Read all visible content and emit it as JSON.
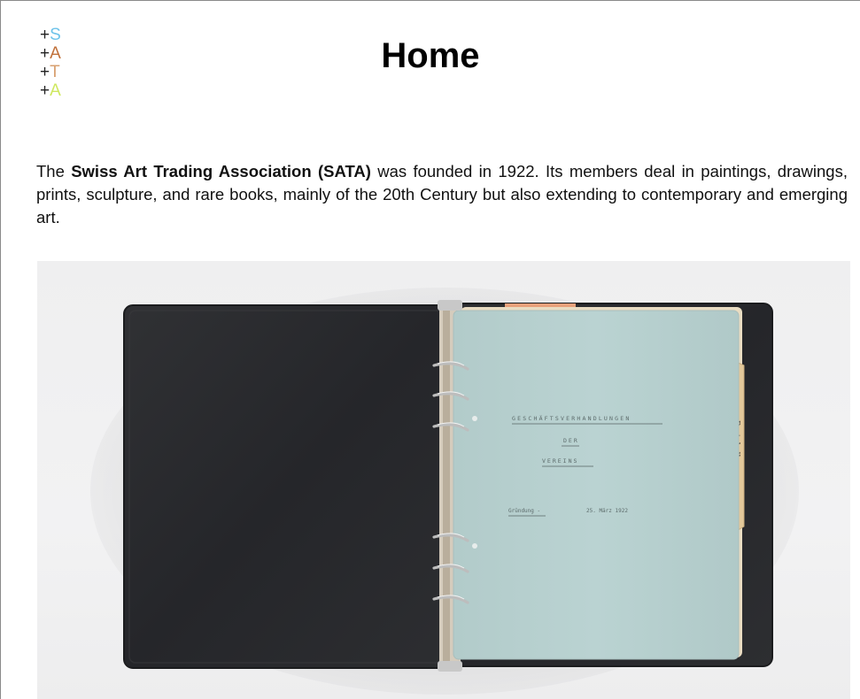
{
  "logo": {
    "plus": "+",
    "letters": [
      {
        "char": "S",
        "color": "#6ec3ea"
      },
      {
        "char": "A",
        "color": "#c0703a"
      },
      {
        "char": "T",
        "color": "#d8a070"
      },
      {
        "char": "A",
        "color": "#cfe860"
      }
    ]
  },
  "page": {
    "title": "Home"
  },
  "intro": {
    "text_before": "The ",
    "bold": "Swiss Art Trading Association (SATA)",
    "text_after": " was founded in 1922. Its members deal in paintings, drawings, prints, sculpture, and rare books, mainly of the 20th Century but also extending to contemporary and emerging art."
  },
  "photo": {
    "colors": {
      "binder": "#2a2b2d",
      "paper": "#b7d0cf",
      "tab": "#e3c89a",
      "ring": "#c9c9c9"
    }
  }
}
